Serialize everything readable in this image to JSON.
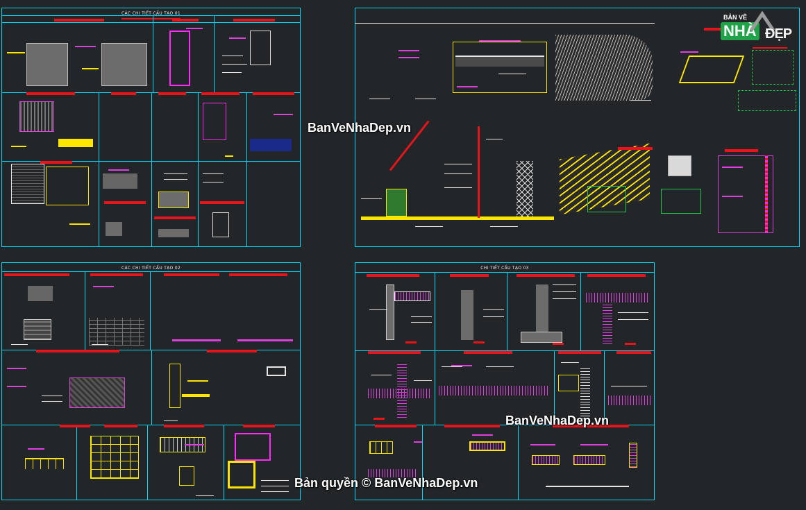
{
  "sheets": {
    "s1_title": "CÁC CHI TIẾT CẤU TẠO 01",
    "s2_title": "CÁC CHI TIẾT CẤU TẠO 02",
    "s3_title": "CHI TIẾT CẤU TẠO 03"
  },
  "watermarks": {
    "top": "BanVeNhaDep.vn",
    "middle": "BanVeNhaDep.vn",
    "bottom": "Bản quyền © BanVeNhaDep.vn"
  },
  "logo": {
    "small": "BẢN VẼ",
    "brand": "NHÀ",
    "suffix": "ĐẸP"
  },
  "colors": {
    "background": "#232629",
    "frame": "#00d8ff",
    "title_bar": "#e8141c",
    "magenta": "#e040e0",
    "yellow": "#ffe600",
    "green": "#21c44a"
  }
}
